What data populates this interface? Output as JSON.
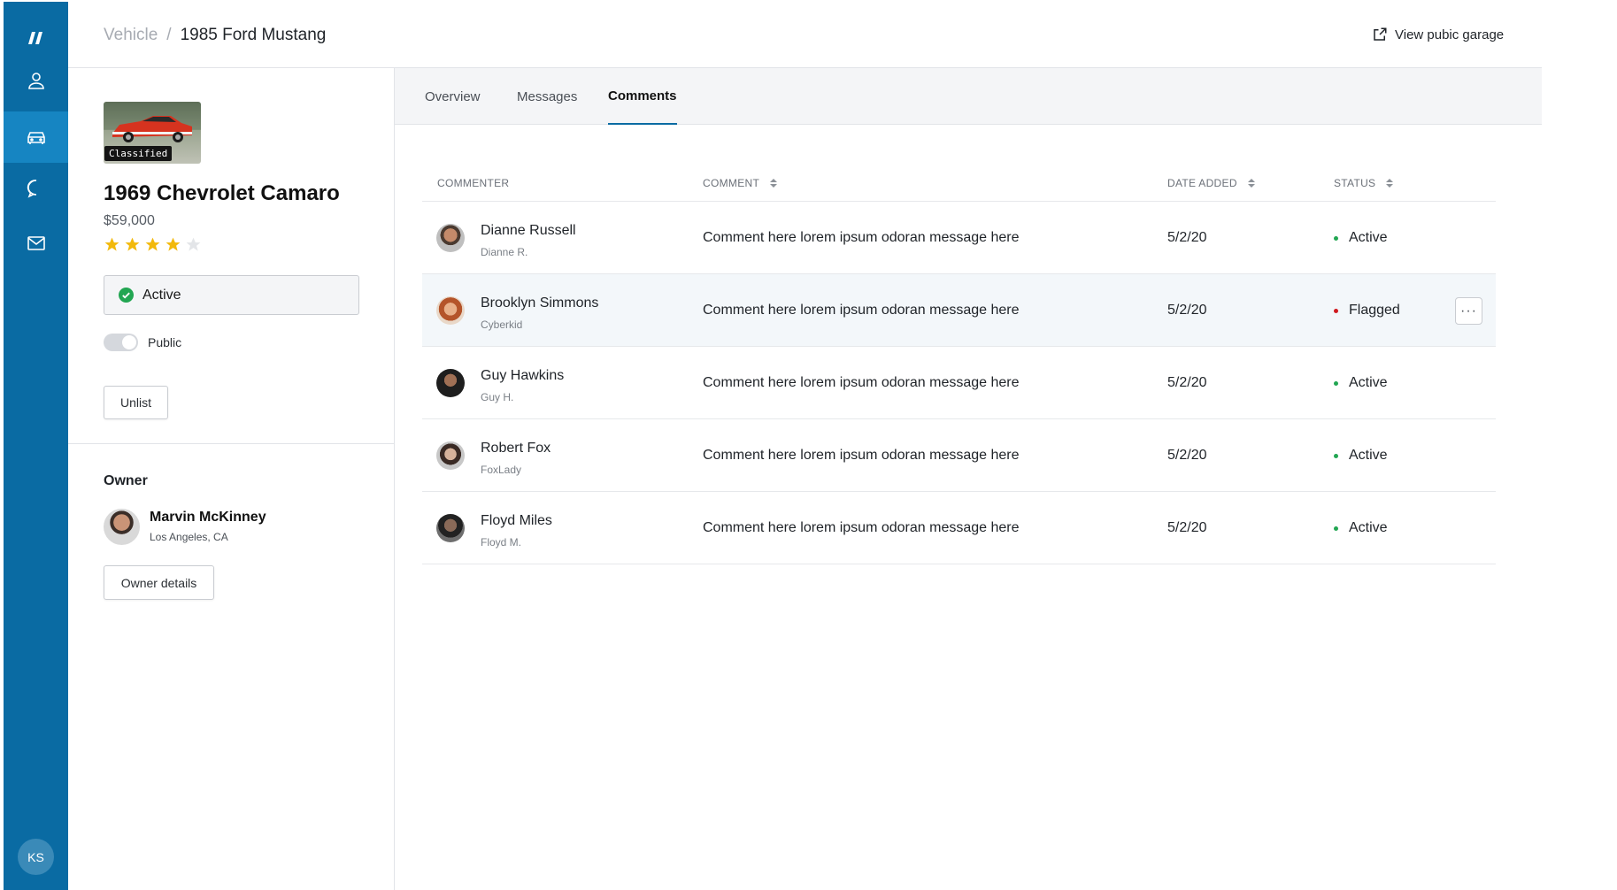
{
  "nav": {
    "items": [
      {
        "name": "user-icon"
      },
      {
        "name": "car-icon",
        "active": true
      },
      {
        "name": "chat-bubble-icon"
      },
      {
        "name": "mail-icon"
      }
    ],
    "user_initials": "KS",
    "colors": {
      "rail": "#0a6ba3",
      "rail_active": "#1685c2"
    }
  },
  "header": {
    "breadcrumb_parent": "Vehicle",
    "breadcrumb_separator": "/",
    "breadcrumb_current": "1985 Ford Mustang",
    "external_link_label": "View pubic garage"
  },
  "vehicle": {
    "thumb_badge": "Classified",
    "title": "1969 Chevrolet Camaro",
    "price": "$59,000",
    "rating": 4,
    "rating_max": 5,
    "status_value": "Active",
    "visibility_label": "Public",
    "unlist_label": "Unlist"
  },
  "owner": {
    "heading": "Owner",
    "name": "Marvin McKinney",
    "location": "Los Angeles, CA",
    "details_button": "Owner details"
  },
  "tabs": [
    {
      "label": "Overview"
    },
    {
      "label": "Messages"
    },
    {
      "label": "Comments",
      "active": true
    }
  ],
  "table": {
    "columns": {
      "commenter": "COMMENTER",
      "comment": "COMMENT",
      "date_added": "DATE ADDED",
      "status": "STATUS"
    },
    "rows": [
      {
        "name": "Dianne Russell",
        "handle": "Dianne R.",
        "comment": "Comment here lorem ipsum odoran message here",
        "date": "5/2/20",
        "status": "Active",
        "status_color": "#22a652"
      },
      {
        "name": "Brooklyn Simmons",
        "handle": "Cyberkid",
        "comment": "Comment here lorem ipsum odoran message here",
        "date": "5/2/20",
        "status": "Flagged",
        "status_color": "#d0191e"
      },
      {
        "name": "Guy Hawkins",
        "handle": "Guy H.",
        "comment": "Comment here lorem ipsum odoran message here",
        "date": "5/2/20",
        "status": "Active",
        "status_color": "#22a652"
      },
      {
        "name": "Robert Fox",
        "handle": "FoxLady",
        "comment": "Comment here lorem ipsum odoran message here",
        "date": "5/2/20",
        "status": "Active",
        "status_color": "#22a652"
      },
      {
        "name": "Floyd Miles",
        "handle": "Floyd M.",
        "comment": "Comment here lorem ipsum odoran message here",
        "date": "5/2/20",
        "status": "Active",
        "status_color": "#22a652"
      }
    ],
    "more_label": "···"
  }
}
